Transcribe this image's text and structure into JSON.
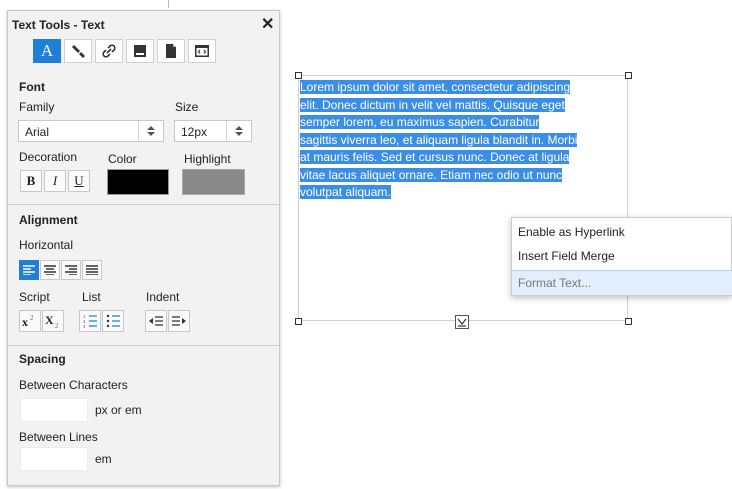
{
  "panel": {
    "title": "Text Tools - Text",
    "close_glyph": "✕",
    "toolbar": [
      {
        "icon": "text-format-icon",
        "glyph": "A",
        "active": true
      },
      {
        "icon": "paint-brush-icon"
      },
      {
        "icon": "link-icon"
      },
      {
        "icon": "insert-field-icon"
      },
      {
        "icon": "document-icon"
      },
      {
        "icon": "code-icon"
      }
    ],
    "font": {
      "heading": "Font",
      "family_label": "Family",
      "family_value": "Arial",
      "size_label": "Size",
      "size_value": "12px",
      "decoration_label": "Decoration",
      "color_label": "Color",
      "highlight_label": "Highlight",
      "bold": "B",
      "italic": "I",
      "underline": "U",
      "color_value": "#000000",
      "highlight_value": "#8a8a8a"
    },
    "alignment": {
      "heading": "Alignment",
      "horizontal_label": "Horizontal",
      "script_label": "Script",
      "list_label": "List",
      "indent_label": "Indent",
      "active_align": "left"
    },
    "spacing": {
      "heading": "Spacing",
      "between_chars_label": "Between Characters",
      "between_chars_unit": "px or em",
      "between_lines_label": "Between Lines",
      "between_lines_unit": "em"
    }
  },
  "canvas": {
    "lines": [
      "Lorem ipsum dolor sit amet, consectetur adipiscing",
      "elit. Donec dictum in velit vel mattis. Quisque eget",
      "semper lorem, eu maximus sapien. Curabitur",
      "sagittis viverra leo, et aliquam ligula blandit in. Morbi",
      "at mauris felis. Sed et cursus nunc. Donec at ligula",
      "vitae lacus aliquet ornare. Etiam nec odio ut nunc",
      "volutpat aliquam."
    ]
  },
  "context_menu": {
    "items": [
      "Enable as Hyperlink",
      "Insert Field Merge",
      "Format Text..."
    ],
    "highlighted_index": 2
  },
  "colors": {
    "accent": "#1f7ed6",
    "selection": "#3b8ee6"
  }
}
